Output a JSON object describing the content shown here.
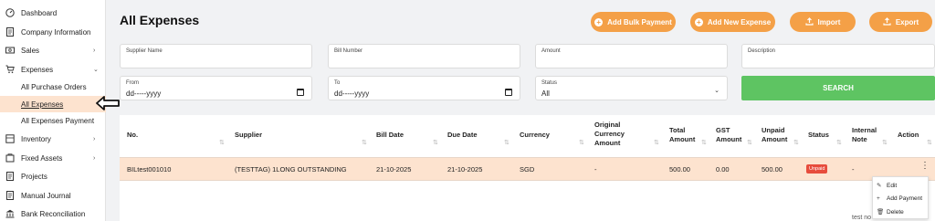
{
  "sidebar": {
    "items": [
      {
        "label": "Dashboard",
        "icon": "dashboard-icon"
      },
      {
        "label": "Company Information",
        "icon": "document-icon"
      },
      {
        "label": "Sales",
        "icon": "sales-icon"
      },
      {
        "label": "Expenses",
        "icon": "cart-icon"
      },
      {
        "label": "All Purchase Orders"
      },
      {
        "label": "All Expenses"
      },
      {
        "label": "All Expenses Payment"
      },
      {
        "label": "Inventory",
        "icon": "inventory-icon"
      },
      {
        "label": "Fixed Assets",
        "icon": "fixed-assets-icon"
      },
      {
        "label": "Projects",
        "icon": "document-icon"
      },
      {
        "label": "Manual Journal",
        "icon": "document-icon"
      },
      {
        "label": "Bank Reconciliation",
        "icon": "bank-icon"
      }
    ]
  },
  "header": {
    "title": "All Expenses",
    "buttons": {
      "bulk_payment": "Add Bulk Payment",
      "new_expense": "Add New Expense",
      "import": "Import",
      "export": "Export"
    }
  },
  "filters": {
    "supplier_name": {
      "label": "Supplier Name",
      "value": ""
    },
    "bill_number": {
      "label": "Bill Number",
      "value": ""
    },
    "amount": {
      "label": "Amount",
      "value": ""
    },
    "description": {
      "label": "Description",
      "value": ""
    },
    "from": {
      "label": "From",
      "value": "dd-----yyyy"
    },
    "to": {
      "label": "To",
      "value": "dd-----yyyy"
    },
    "status": {
      "label": "Status",
      "value": "All"
    },
    "search": "SEARCH"
  },
  "table": {
    "headers": {
      "no": "No.",
      "supplier": "Supplier",
      "bill_date": "Bill Date",
      "due_date": "Due Date",
      "currency": "Currency",
      "orig_1": "Original",
      "orig_2": "Currency",
      "orig_3": "Amount",
      "total_1": "Total",
      "total_2": "Amount",
      "gst_1": "GST",
      "gst_2": "Amount",
      "unpaid_1": "Unpaid",
      "unpaid_2": "Amount",
      "status": "Status",
      "note_1": "Internal",
      "note_2": "Note",
      "action": "Action"
    },
    "rows": [
      {
        "no": "BILtest001010",
        "supplier": "(TESTTAG) 1LONG OUTSTANDING",
        "bill_date": "21-10-2025",
        "due_date": "21-10-2025",
        "currency": "SGD",
        "original_amount": "-",
        "total_amount": "500.00",
        "gst_amount": "0.00",
        "unpaid_amount": "500.00",
        "status": "Unpaid",
        "internal_note": "-"
      }
    ]
  },
  "menu": {
    "edit": "Edit",
    "add_payment": "Add Payment",
    "delete": "Delete"
  },
  "below_text": "test no",
  "colors": {
    "accent": "#f4a047",
    "search": "#5ec462",
    "row_highlight": "#fde3cf",
    "badge": "#e74c3c"
  }
}
